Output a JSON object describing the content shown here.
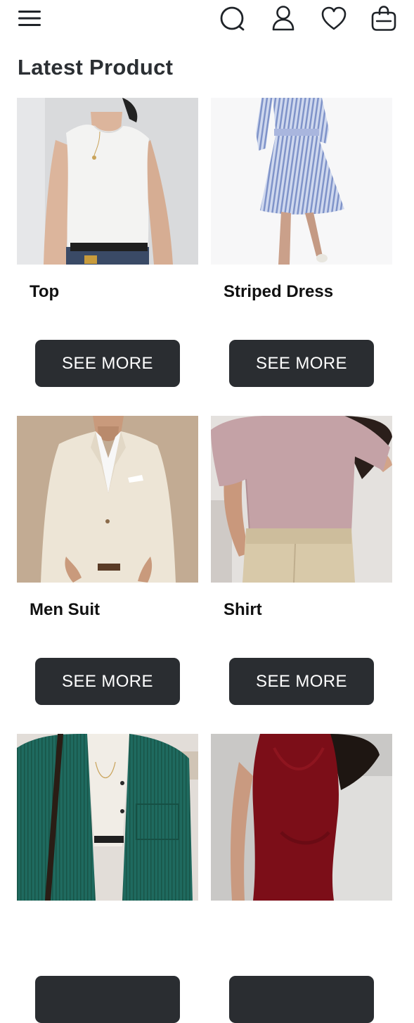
{
  "header": {
    "icons": [
      "menu-icon",
      "search-icon",
      "user-icon",
      "heart-icon",
      "shopping-bag-icon"
    ]
  },
  "page_title": "Latest Product",
  "products": [
    {
      "name": "Top",
      "button_label": "SEE MORE"
    },
    {
      "name": "Striped Dress",
      "button_label": "SEE MORE"
    },
    {
      "name": "Men Suit",
      "button_label": "SEE MORE"
    },
    {
      "name": "Shirt",
      "button_label": "SEE MORE"
    },
    {
      "name": "",
      "button_label": ""
    },
    {
      "name": "",
      "button_label": ""
    }
  ],
  "colors": {
    "button_bg": "#2a2d31",
    "button_text": "#ffffff",
    "title": "#2b2f33"
  }
}
